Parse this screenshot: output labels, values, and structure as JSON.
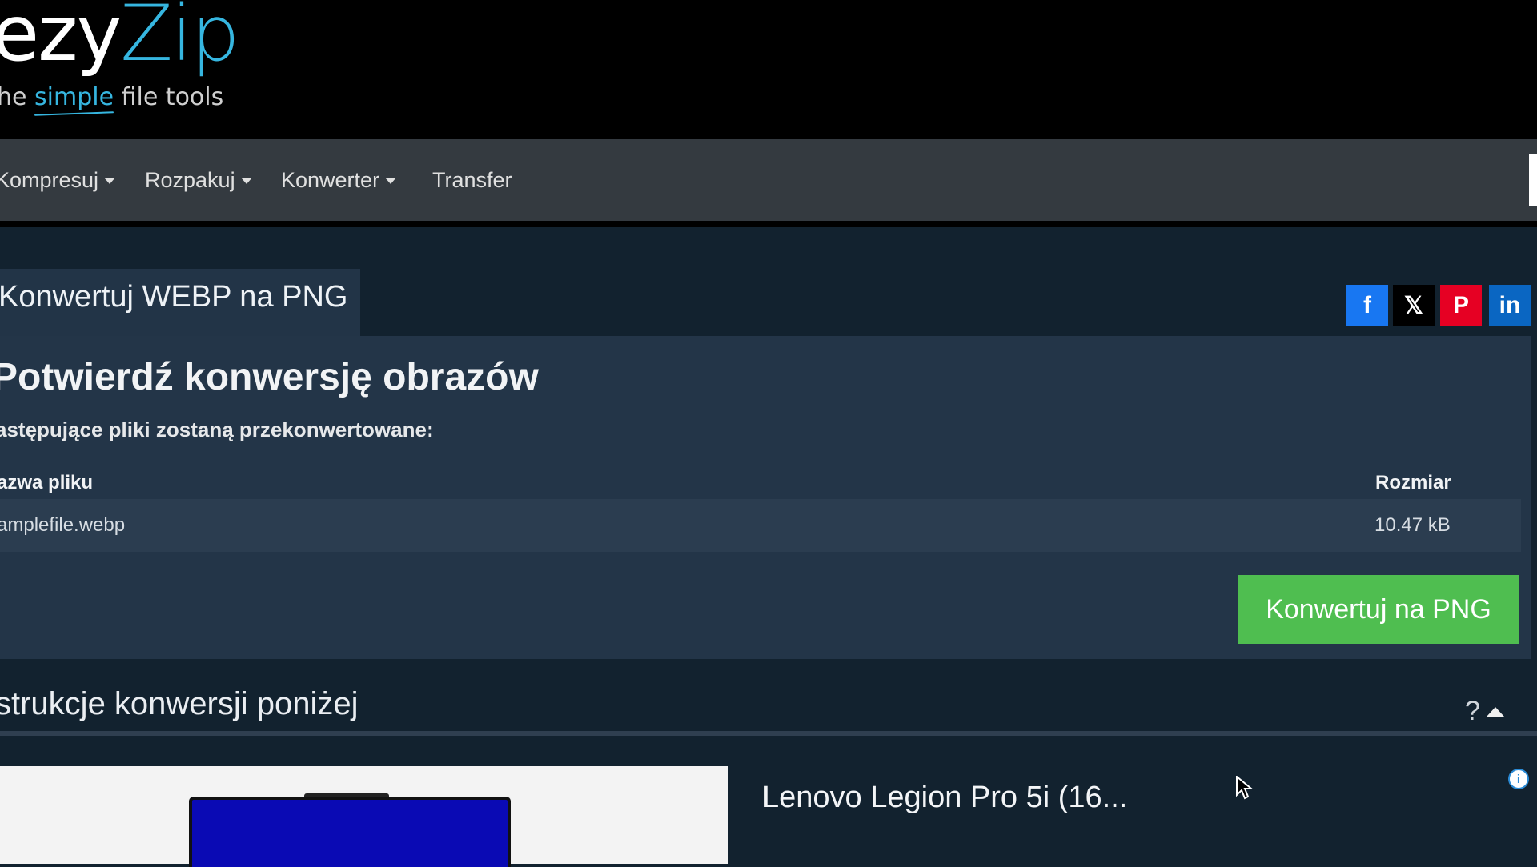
{
  "logo": {
    "part1": "ezy",
    "part2": "Zip",
    "tagline_pre": "he ",
    "tagline_hl": "simple",
    "tagline_post": " file tools"
  },
  "nav": {
    "items": [
      {
        "label": "Kompresuj",
        "dropdown": true
      },
      {
        "label": "Rozpakuj",
        "dropdown": true
      },
      {
        "label": "Konwerter",
        "dropdown": true
      },
      {
        "label": "Transfer",
        "dropdown": false
      }
    ]
  },
  "tab": {
    "label": "Konwertuj WEBP na PNG"
  },
  "share": {
    "facebook": "f",
    "x": "𝕏",
    "pinterest": "P",
    "linkedin": "in"
  },
  "panel": {
    "title": "Potwierdź konwersję obrazów",
    "subtitle": "astępujące pliki zostaną przekonwertowane:",
    "columns": {
      "name": "azwa pliku",
      "size": "Rozmiar"
    },
    "rows": [
      {
        "name": "amplefile.webp",
        "size": "10.47 kB"
      }
    ],
    "convert_button": "Konwertuj na PNG"
  },
  "instructions": {
    "label": "strukcje konwersji poniżej",
    "help": "?"
  },
  "ad": {
    "title": "Lenovo Legion Pro 5i (16...",
    "info": "i"
  },
  "colors": {
    "accent": "#36b6e0",
    "convert_button": "#4fbe50",
    "panel": "#233548",
    "background": "#12222f",
    "navbar": "#343a40"
  }
}
